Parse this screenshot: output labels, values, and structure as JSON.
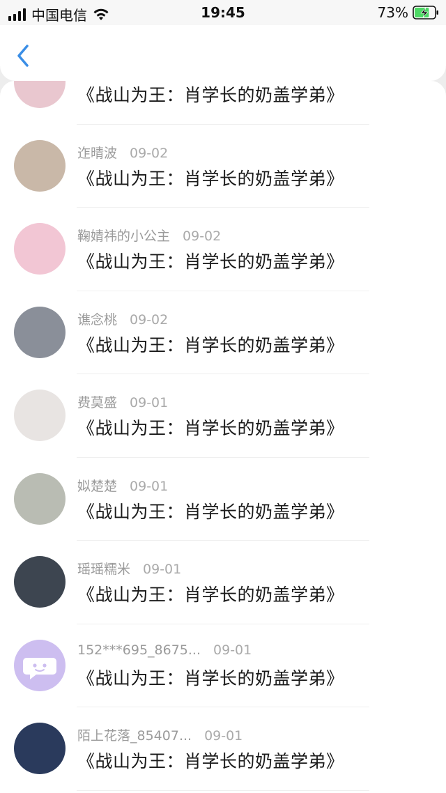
{
  "status_bar": {
    "carrier": "中国电信",
    "time": "19:45",
    "battery_percent": "73%",
    "battery_level": 0.73,
    "charging": true
  },
  "nav": {
    "back_icon": "chevron-left-icon",
    "accent_color": "#3a8ee6"
  },
  "messages": [
    {
      "user": "",
      "date": "",
      "text": "《战山为王：肖学长的奶盖学弟》",
      "avatar_color": "#e9c7cf"
    },
    {
      "user": "迮晴波",
      "date": "09-02",
      "text": "《战山为王：肖学长的奶盖学弟》",
      "avatar_color": "#c9b8a8"
    },
    {
      "user": "鞠婧祎的小公主",
      "date": "09-02",
      "text": "《战山为王：肖学长的奶盖学弟》",
      "avatar_color": "#f2c6d4"
    },
    {
      "user": "谯念桃",
      "date": "09-02",
      "text": "《战山为王：肖学长的奶盖学弟》",
      "avatar_color": "#8a8f99"
    },
    {
      "user": "费莫盛",
      "date": "09-01",
      "text": "《战山为王：肖学长的奶盖学弟》",
      "avatar_color": "#e8e4e2"
    },
    {
      "user": "姒楚楚",
      "date": "09-01",
      "text": "《战山为王：肖学长的奶盖学弟》",
      "avatar_color": "#b9bcb3"
    },
    {
      "user": "瑶瑶糯米",
      "date": "09-01",
      "text": "《战山为王：肖学长的奶盖学弟》",
      "avatar_color": "#3d4550"
    },
    {
      "user": "152***695_8675...",
      "date": "09-01",
      "text": "《战山为王：肖学长的奶盖学弟》",
      "avatar_color": "#cdbef0",
      "avatar_icon": "chat-bubble-icon"
    },
    {
      "user": "陌上花落_85407...",
      "date": "09-01",
      "text": "《战山为王：肖学长的奶盖学弟》",
      "avatar_color": "#2a3a5c"
    }
  ]
}
